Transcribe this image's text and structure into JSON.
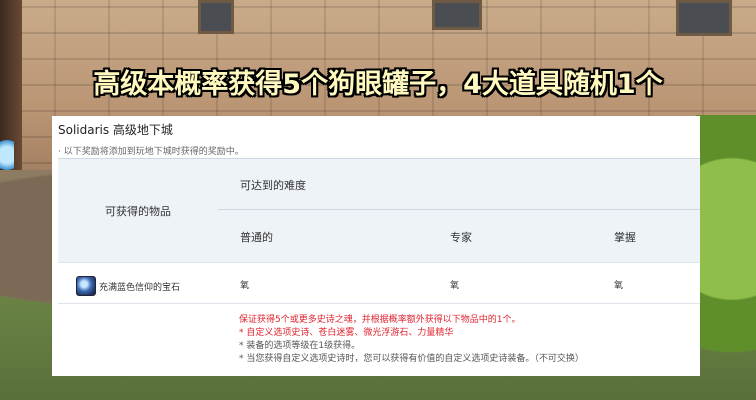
{
  "headline": "高级本概率获得5个狗眼罐子，4大道具随机1个",
  "panel": {
    "title": "Solidaris 高级地下城",
    "note": "· 以下奖励将添加到玩地下城时获得的奖励中。"
  },
  "table": {
    "col_item_header": "可获得的物品",
    "col_difficulty_header": "可达到的难度",
    "difficulties": [
      "普通的",
      "专家",
      "掌握"
    ],
    "rows": [
      {
        "item": "充满蓝色信仰的宝石",
        "values": [
          "氧",
          "氧",
          "氧"
        ]
      }
    ]
  },
  "notes": {
    "line1": "保证获得5个或更多史诗之魂，并根据概率额外获得以下物品中的1个。",
    "line2": "* 自定义选项史诗、苍白迷雾、微光浮游石、力量精华",
    "line3": "* 装备的选项等级在1级获得。",
    "line4": "* 当您获得自定义选项史诗时，您可以获得有价值的自定义选项史诗装备。（不可交换）"
  },
  "colors": {
    "headline": "#fff9c0",
    "accent_red": "#e0242f",
    "header_bg": "#eef3f8"
  }
}
